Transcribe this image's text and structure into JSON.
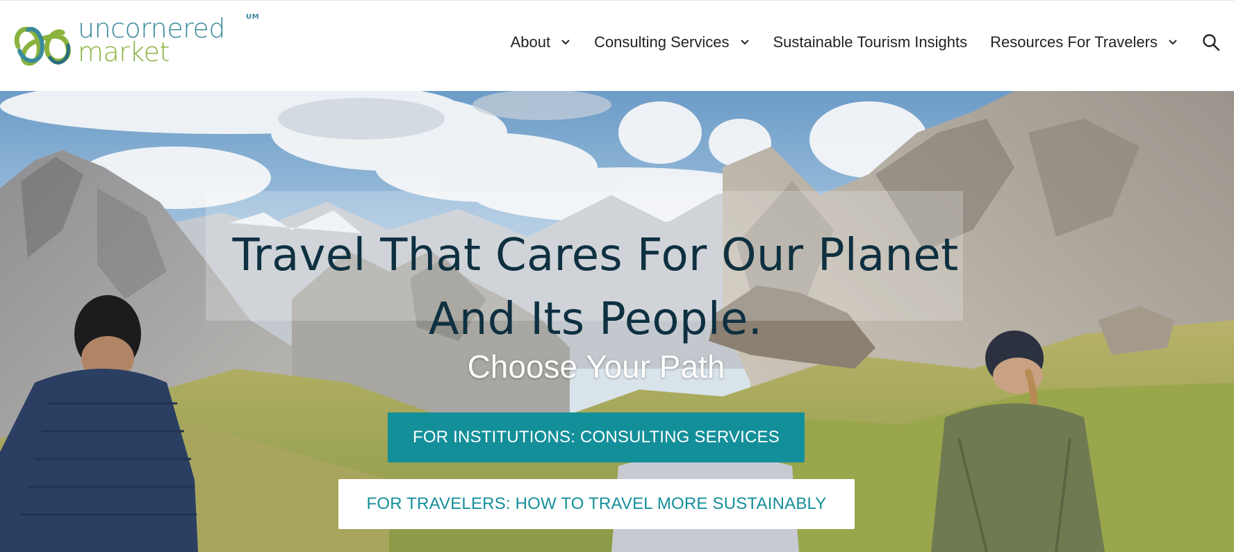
{
  "logo": {
    "line1": "uncornered",
    "line2": "market",
    "badge": "UM",
    "icon": "infinity-loop-logo-icon",
    "colors": {
      "teal": "#3a8a9a",
      "green": "#8ab33e"
    }
  },
  "nav": {
    "items": [
      {
        "label": "About",
        "has_dropdown": true
      },
      {
        "label": "Consulting Services",
        "has_dropdown": true
      },
      {
        "label": "Sustainable Tourism Insights",
        "has_dropdown": false
      },
      {
        "label": "Resources For Travelers",
        "has_dropdown": true
      }
    ],
    "search_icon": "search-icon"
  },
  "hero": {
    "headline_line1": "Travel That Cares For Our Planet",
    "headline_line2": "And Its People.",
    "subhead": "Choose Your Path",
    "primary_cta": "FOR INSTITUTIONS: CONSULTING SERVICES",
    "secondary_cta": "FOR TRAVELERS: HOW TO TRAVEL MORE SUSTAINABLY",
    "colors": {
      "accent": "#138f9a",
      "headline": "#0e3040"
    }
  }
}
